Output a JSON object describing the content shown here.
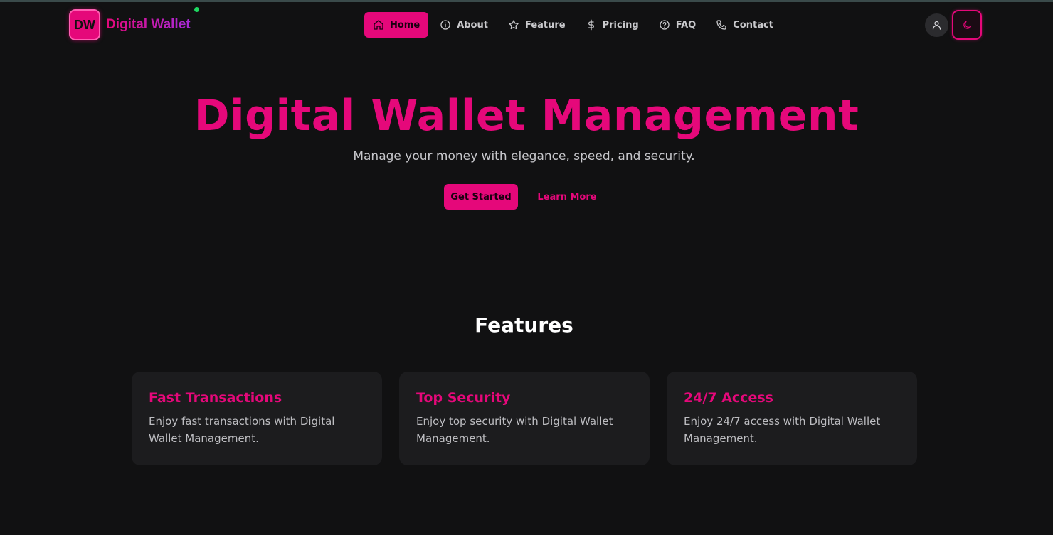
{
  "brand": {
    "logo_text": "DW",
    "name": "Digital Wallet"
  },
  "nav": {
    "items": [
      {
        "label": "Home",
        "icon": "home-icon",
        "active": true
      },
      {
        "label": "About",
        "icon": "info-icon",
        "active": false
      },
      {
        "label": "Feature",
        "icon": "star-icon",
        "active": false
      },
      {
        "label": "Pricing",
        "icon": "dollar-icon",
        "active": false
      },
      {
        "label": "FAQ",
        "icon": "help-circle-icon",
        "active": false
      },
      {
        "label": "Contact",
        "icon": "phone-icon",
        "active": false
      }
    ]
  },
  "actions": {
    "user_icon": "user-icon",
    "theme_icon": "moon-icon"
  },
  "hero": {
    "title": "Digital Wallet Management",
    "subtitle": "Manage your money with elegance, speed, and security.",
    "primary_cta": "Get Started",
    "secondary_cta": "Learn More"
  },
  "features": {
    "heading": "Features",
    "cards": [
      {
        "title": "Fast Transactions",
        "description": "Enjoy fast transactions with Digital Wallet Management."
      },
      {
        "title": "Top Security",
        "description": "Enjoy top security with Digital Wallet Management."
      },
      {
        "title": "24/7 Access",
        "description": "Enjoy 24/7 access with Digital Wallet Management."
      }
    ]
  },
  "colors": {
    "accent": "#e5087a",
    "background": "#111112",
    "card": "#1c1c1e",
    "status_online": "#1ed760"
  }
}
